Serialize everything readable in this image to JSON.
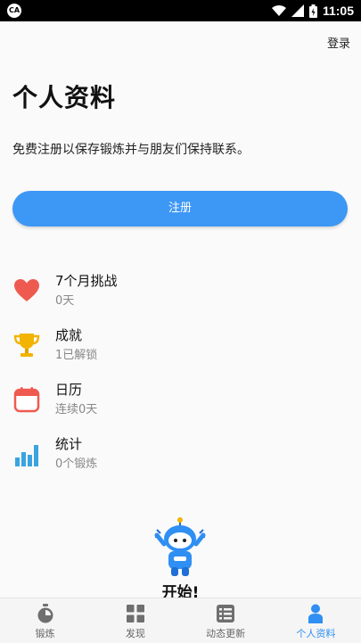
{
  "status_bar": {
    "time": "11:05"
  },
  "header": {
    "login_label": "登录"
  },
  "page": {
    "title": "个人资料",
    "subtitle": "免费注册以保存锻炼并与朋友们保持联系。",
    "register_label": "注册"
  },
  "stats": [
    {
      "icon": "heart-icon",
      "title": "7个月挑战",
      "subtitle": "0天"
    },
    {
      "icon": "trophy-icon",
      "title": "成就",
      "subtitle": "1已解锁"
    },
    {
      "icon": "calendar-icon",
      "title": "日历",
      "subtitle": "连续0天"
    },
    {
      "icon": "chart-icon",
      "title": "统计",
      "subtitle": "0个锻炼"
    }
  ],
  "start": {
    "label": "开始!"
  },
  "bottom_nav": [
    {
      "icon": "stopwatch-icon",
      "label": "锻炼",
      "active": false
    },
    {
      "icon": "grid-icon",
      "label": "发现",
      "active": false
    },
    {
      "icon": "feed-list-icon",
      "label": "动态更新",
      "active": false
    },
    {
      "icon": "person-icon",
      "label": "个人资料",
      "active": true
    }
  ],
  "colors": {
    "accent": "#3d97f5",
    "heart": "#ef5a50",
    "trophy": "#f2b400",
    "calendar": "#ef5a50",
    "chart": "#3aa3e0"
  }
}
